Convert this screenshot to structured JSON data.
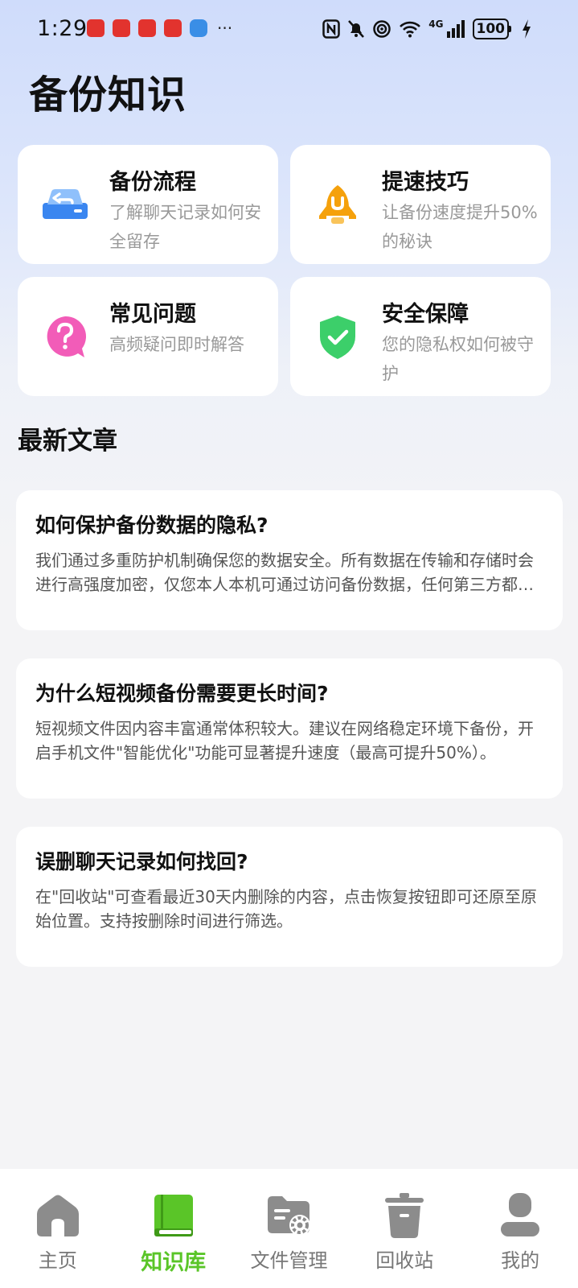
{
  "status_bar": {
    "time": "1:29",
    "network": "4G",
    "battery": "100"
  },
  "header": {
    "title": "备份知识"
  },
  "categories": [
    {
      "title": "备份流程",
      "desc": "了解聊天记录如何安全留存",
      "icon": "backup-drive-icon",
      "color": "#3a86f0"
    },
    {
      "title": "提速技巧",
      "desc": "让备份速度提升50%的秘诀",
      "icon": "rocket-icon",
      "color": "#f5a10c"
    },
    {
      "title": "常见问题",
      "desc": "高频疑问即时解答",
      "icon": "question-bubble-icon",
      "color": "#f25cb8"
    },
    {
      "title": "安全保障",
      "desc": "您的隐私权如何被守护",
      "icon": "shield-check-icon",
      "color": "#3ccf6a"
    }
  ],
  "articles_section": {
    "title": "最新文章",
    "items": [
      {
        "title": "如何保护备份数据的隐私?",
        "summary": "我们通过多重防护机制确保您的数据安全。所有数据在传输和存储时会进行高强度加密，仅您本人本机可通过访问备份数据，任何第三方都无法获取。"
      },
      {
        "title": "为什么短视频备份需要更长时间?",
        "summary": "短视频文件因内容丰富通常体积较大。建议在网络稳定环境下备份，开启手机文件\"智能优化\"功能可显著提升速度（最高可提升50%）。"
      },
      {
        "title": "误删聊天记录如何找回?",
        "summary": "在\"回收站\"可查看最近30天内删除的内容，点击恢复按钮即可还原至原始位置。支持按删除时间进行筛选。"
      }
    ]
  },
  "bottom_nav": {
    "items": [
      {
        "label": "主页",
        "icon": "home-icon"
      },
      {
        "label": "知识库",
        "icon": "book-icon",
        "active": true
      },
      {
        "label": "文件管理",
        "icon": "folder-settings-icon"
      },
      {
        "label": "回收站",
        "icon": "trash-icon"
      },
      {
        "label": "我的",
        "icon": "user-icon"
      }
    ]
  },
  "colors": {
    "accent_green": "#5ac528",
    "nav_gray": "#8c8c8c"
  }
}
